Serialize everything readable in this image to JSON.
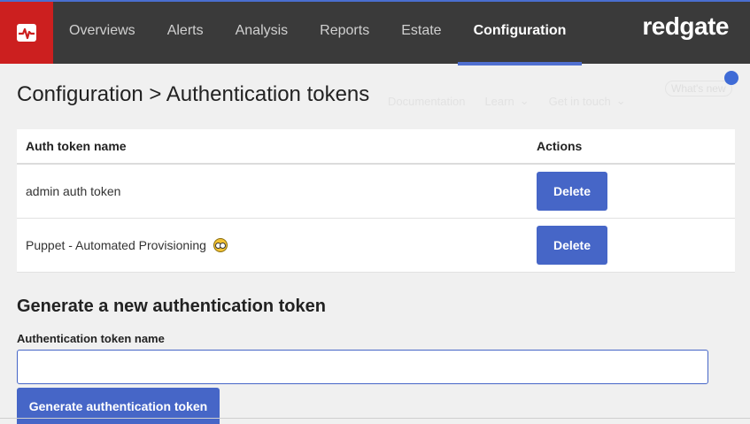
{
  "topbar": {
    "nav": [
      {
        "label": "Overviews",
        "active": false
      },
      {
        "label": "Alerts",
        "active": false
      },
      {
        "label": "Analysis",
        "active": false
      },
      {
        "label": "Reports",
        "active": false
      },
      {
        "label": "Estate",
        "active": false
      },
      {
        "label": "Configuration",
        "active": true
      }
    ],
    "brand": "redgate",
    "logo_icon": "pulse-monitor-icon",
    "colors": {
      "bar": "#3a3a3a",
      "logo": "#cc1f1f",
      "accent": "#4f6fd0"
    }
  },
  "page": {
    "title": "Configuration > Authentication tokens",
    "ghost_links": [
      "Documentation",
      "Learn",
      "Get in touch"
    ],
    "whats_new": "What's new"
  },
  "table": {
    "headers": {
      "name": "Auth token name",
      "actions": "Actions"
    },
    "rows": [
      {
        "name": "admin auth token",
        "action": "Delete"
      },
      {
        "name": "Puppet - Automated Provisioning",
        "action": "Delete",
        "emoji": "nerd-face-icon"
      }
    ]
  },
  "form": {
    "section_title": "Generate a new authentication token",
    "field_label": "Authentication token name",
    "input_value": "",
    "submit_label": "Generate authentication token"
  }
}
